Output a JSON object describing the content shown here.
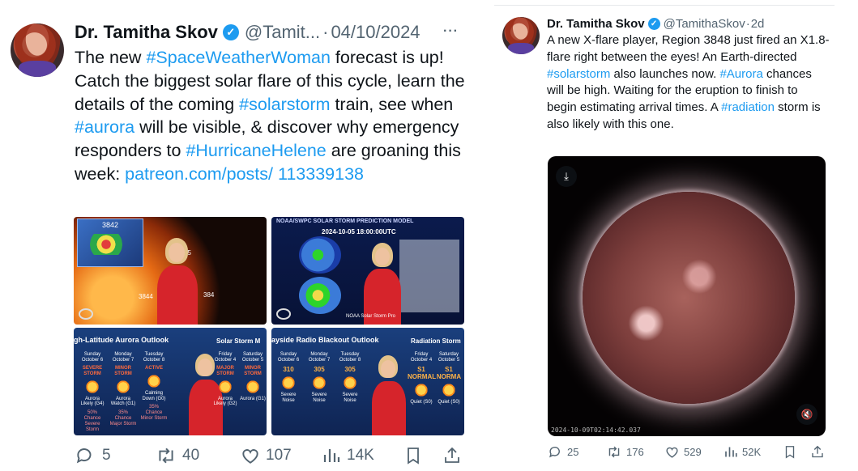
{
  "left_tweet": {
    "author_name": "Dr. Tamitha Skov",
    "handle": "@Tamit...",
    "separator": "·",
    "date": "04/10/2024",
    "more": "···",
    "text_parts": [
      {
        "t": "The new ",
        "link": false
      },
      {
        "t": "#SpaceWeatherWoman",
        "link": true
      },
      {
        "t": " forecast is up! Catch the biggest solar flare of this cycle, learn the details of the coming ",
        "link": false
      },
      {
        "t": "#solarstorm",
        "link": true
      },
      {
        "t": " train, see when ",
        "link": false
      },
      {
        "t": "#aurora",
        "link": true
      },
      {
        "t": " will be visible, & discover why emergency responders to ",
        "link": false
      },
      {
        "t": "#HurricaneHelene",
        "link": true
      },
      {
        "t": " are groaning this week: ",
        "link": false
      },
      {
        "t": "patreon.com/posts/ 113339138",
        "link": true
      }
    ],
    "media": {
      "sun_label_3842": "3842",
      "sun_label_3844": "3844",
      "sun_label_45": "45",
      "sun_label_384": "384",
      "model_title": "NOAA/SWPC SOLAR STORM PREDICTION MODEL",
      "model_time": "2024-10-05 18:00:00UTC",
      "model_caption": "NOAA Solar Storm Pro",
      "aurora_title": "gh-Latitude Aurora Outlook",
      "aurora_right_title": "Solar Storm M",
      "aurora_days": [
        {
          "day": "Sunday October 6",
          "status": "SEVERE STORM",
          "note": "Aurora Likely (G4)",
          "chance": "50% Chance Severe Storm"
        },
        {
          "day": "Monday October 7",
          "status": "MINOR STORM",
          "note": "Aurora Watch (G1)",
          "chance": "35% Chance Major Storm"
        },
        {
          "day": "Tuesday October 8",
          "status": "ACTIVE",
          "note": "Calming Down (G0)",
          "chance": "35% Chance Minor Storm"
        }
      ],
      "aurora_days_right": [
        {
          "day": "Friday October 4",
          "status": "MAJOR STORM",
          "note": "Aurora Likely (G2)"
        },
        {
          "day": "Saturday October 5",
          "status": "MINOR STORM",
          "note": "Aurora (G1)"
        }
      ],
      "radio_title": "ayside Radio Blackout Outlook",
      "radio_right_title": "Radiation Storm",
      "radio_days": [
        {
          "day": "Sunday October 6",
          "value": "310",
          "note": "Severe Noise"
        },
        {
          "day": "Monday October 7",
          "value": "305",
          "note": "Severe Noise"
        },
        {
          "day": "Tuesday October 8",
          "value": "305",
          "note": "Severe Noise"
        }
      ],
      "radio_days_right": [
        {
          "day": "Friday October 4",
          "value": "S1 NORMAL",
          "note": "Quiet (S0)"
        },
        {
          "day": "Saturday October 5",
          "value": "S1 NORMA",
          "note": "Quiet (S0)"
        }
      ]
    },
    "actions": {
      "reply": "5",
      "retweet": "40",
      "like": "107",
      "views": "14K"
    }
  },
  "right_tweet": {
    "author_name": "Dr. Tamitha Skov",
    "handle": "@TamithaSkov",
    "time": "2d",
    "separator": "·",
    "text_parts": [
      {
        "t": "A new X-flare player, Region 3848 just fired an X1.8-flare right between the eyes! An Earth-directed ",
        "link": false
      },
      {
        "t": "#solarstorm",
        "link": true
      },
      {
        "t": " also launches now. ",
        "link": false
      },
      {
        "t": "#Aurora",
        "link": true
      },
      {
        "t": " chances will be high. Waiting for the eruption to finish to begin estimating arrival times. A ",
        "link": false
      },
      {
        "t": "#radiation",
        "link": true
      },
      {
        "t": " storm is also likely with this one.",
        "link": false
      }
    ],
    "video_timestamp": "2024-10-09T02:14:42.037",
    "actions": {
      "reply": "25",
      "retweet": "176",
      "like": "529",
      "views": "52K"
    }
  },
  "colors": {
    "link": "#1d9bf0",
    "muted": "#536471",
    "text": "#0f1419"
  }
}
